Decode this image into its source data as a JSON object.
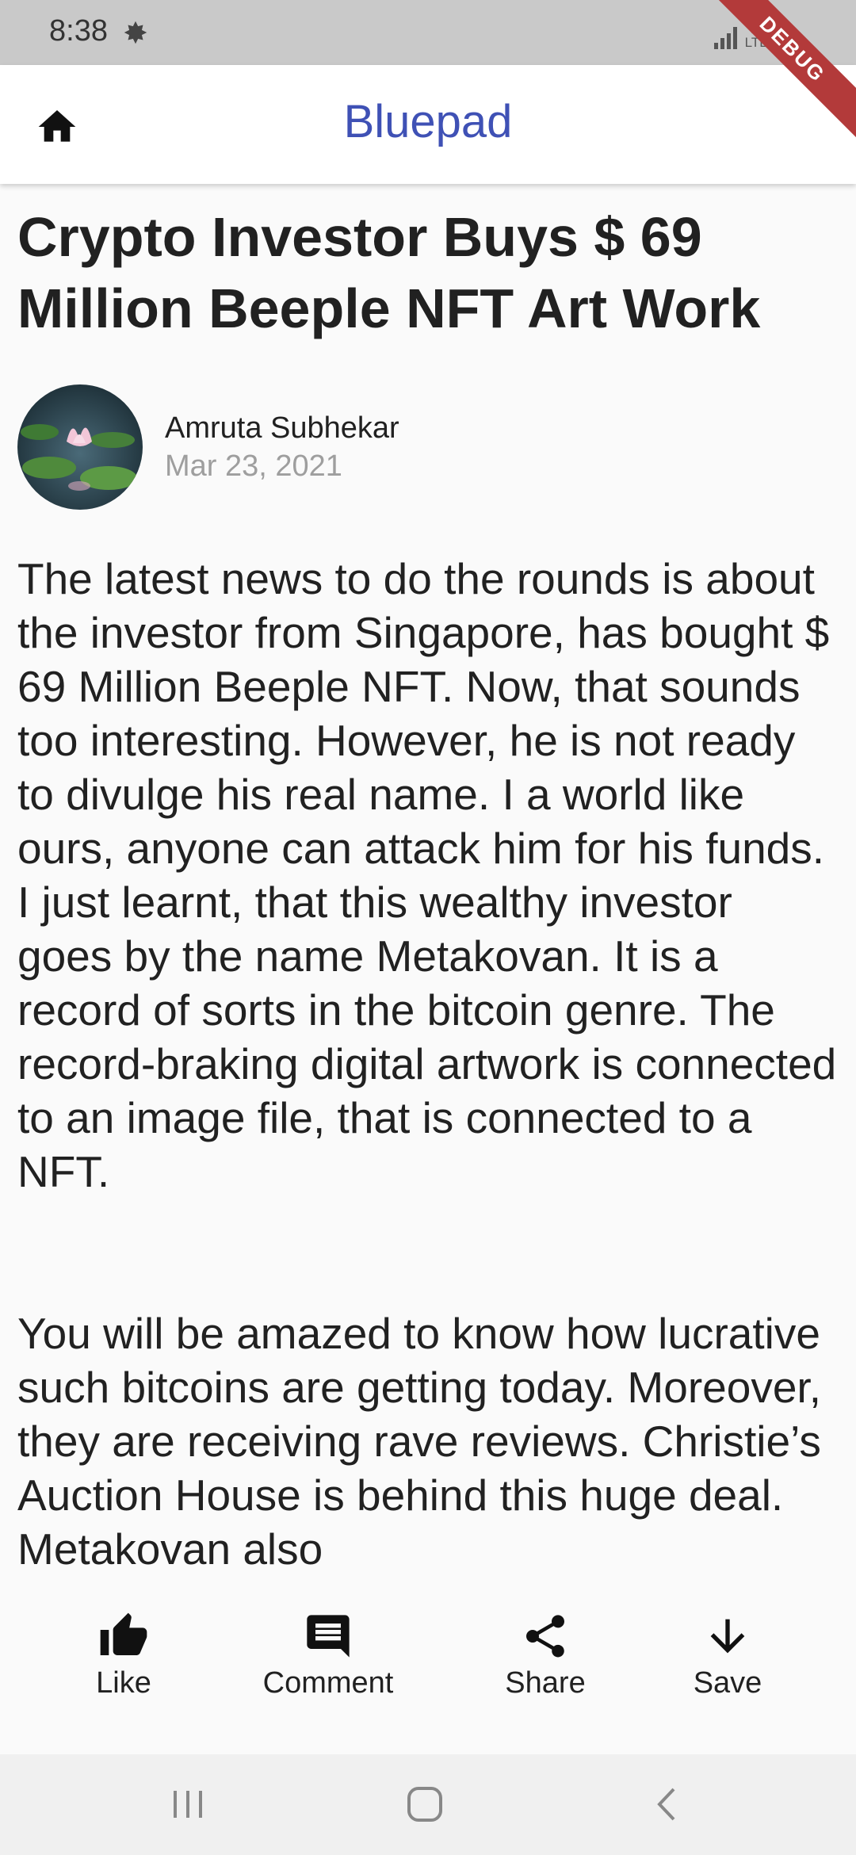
{
  "status_bar": {
    "time": "8:38",
    "lte_top": "Vo))",
    "lte_bottom": "LTE2",
    "debug_label": "DEBUG"
  },
  "app_bar": {
    "title": "Bluepad",
    "home_icon": "home-icon",
    "title_color": "#3f51b5"
  },
  "article": {
    "title": "Crypto Investor Buys $ 69 Million Beeple NFT Art Work",
    "author": "Amruta Subhekar",
    "date": "Mar 23, 2021",
    "body": "The latest news to do the rounds is about the investor from Singapore, has bought $ 69 Million Beeple NFT. Now, that sounds too interesting. However, he is not ready to divulge his real name. I a world like ours, anyone can attack him for his funds. I just learnt, that this wealthy investor goes by the name Metakovan. It is a record of sorts in the bitcoin genre. The record-braking digital artwork is connected to an image file, that is connected to a NFT.\n\n\nYou will be amazed to know how lucrative such bitcoins are getting today. Moreover, they are receiving rave reviews. Christie’s Auction House is behind this huge deal. Metakovan also"
  },
  "actions": [
    {
      "label": "Like",
      "icon": "thumb-up-icon"
    },
    {
      "label": "Comment",
      "icon": "comment-icon"
    },
    {
      "label": "Share",
      "icon": "share-icon"
    },
    {
      "label": "Save",
      "icon": "arrow-down-icon"
    }
  ],
  "nav_bar": {
    "icons": [
      "recent-apps-icon",
      "home-circle-icon",
      "back-icon"
    ]
  }
}
